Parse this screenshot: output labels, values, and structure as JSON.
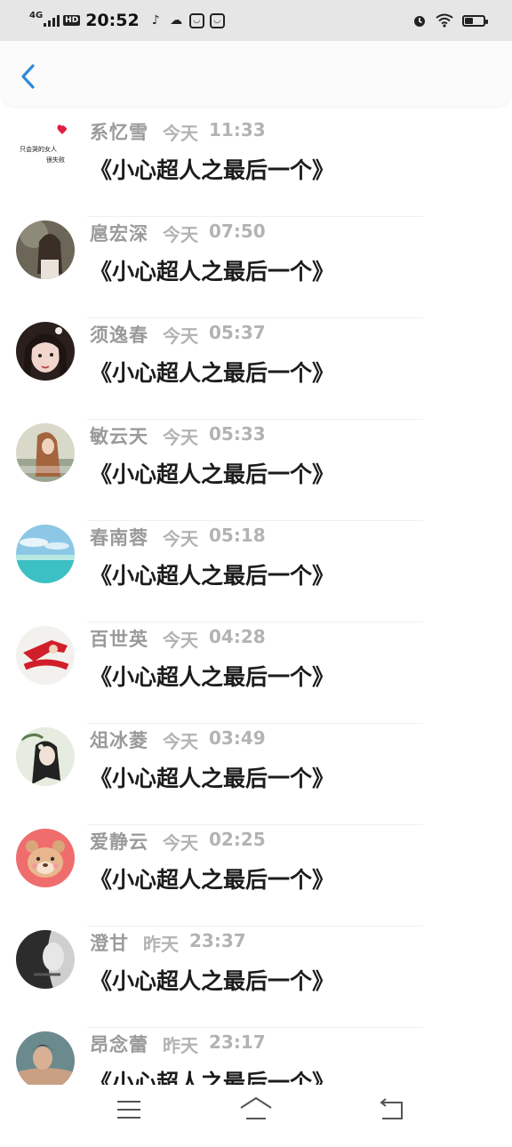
{
  "status_bar": {
    "network": "4G",
    "hd": "HD",
    "time": "20:52",
    "battery_level": 0.45
  },
  "header": {
    "back_icon": "chevron-left-icon",
    "accent": "#2f8ad8"
  },
  "messages": [
    {
      "name": "系忆雪",
      "day": "今天",
      "time": "11:33",
      "title": "《小心超人之最后一个》",
      "avatar": "text-art"
    },
    {
      "name": "扈宏深",
      "day": "今天",
      "time": "07:50",
      "title": "《小心超人之最后一个》",
      "avatar": "photo-dark"
    },
    {
      "name": "须逸春",
      "day": "今天",
      "time": "05:37",
      "title": "《小心超人之最后一个》",
      "avatar": "photo-girl"
    },
    {
      "name": "敏云天",
      "day": "今天",
      "time": "05:33",
      "title": "《小心超人之最后一个》",
      "avatar": "photo-warm"
    },
    {
      "name": "春南蓉",
      "day": "今天",
      "time": "05:18",
      "title": "《小心超人之最后一个》",
      "avatar": "photo-sea"
    },
    {
      "name": "百世英",
      "day": "今天",
      "time": "04:28",
      "title": "《小心超人之最后一个》",
      "avatar": "photo-red"
    },
    {
      "name": "俎冰菱",
      "day": "今天",
      "time": "03:49",
      "title": "《小心超人之最后一个》",
      "avatar": "photo-green"
    },
    {
      "name": "爱静云",
      "day": "今天",
      "time": "02:25",
      "title": "《小心超人之最后一个》",
      "avatar": "cartoon-bear"
    },
    {
      "name": "澄甘",
      "day": "昨天",
      "time": "23:37",
      "title": "《小心超人之最后一个》",
      "avatar": "photo-gray"
    },
    {
      "name": "昂念蕾",
      "day": "昨天",
      "time": "23:17",
      "title": "《小心超人之最后一个》",
      "avatar": "photo-man"
    }
  ],
  "avatar_texts": {
    "line1": "只会哭的女人",
    "line2": "很失败"
  },
  "nav": {
    "menu": "menu-icon",
    "home": "home-icon",
    "back": "back-icon"
  }
}
